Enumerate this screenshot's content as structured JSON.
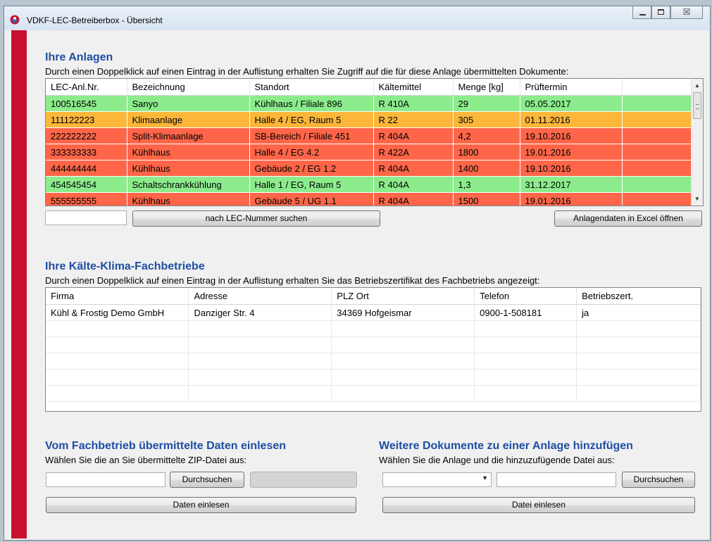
{
  "window": {
    "title": "VDKF-LEC-Betreiberbox - Übersicht",
    "close_glyph": "☒"
  },
  "anlagen": {
    "title": "Ihre Anlagen",
    "description": "Durch einen Doppelklick auf einen Eintrag in der Auflistung erhalten Sie Zugriff auf die für diese Anlage übermittelten Dokumente:",
    "columns": [
      "LEC-Anl.Nr.",
      "Bezeichnung",
      "Standort",
      "Kältemittel",
      "Menge [kg]",
      "Prüftermin",
      ""
    ],
    "rows": [
      {
        "status": "green",
        "cells": [
          "100516545",
          "Sanyo",
          "Kühlhaus / Filiale 896",
          "R 410A",
          "29",
          "05.05.2017",
          ""
        ]
      },
      {
        "status": "orange",
        "cells": [
          "111122223",
          "Klimaanlage",
          "Halle 4 / EG, Raum 5",
          "R 22",
          "305",
          "01.11.2016",
          ""
        ]
      },
      {
        "status": "red",
        "cells": [
          "222222222",
          "Split-Klimaanlage",
          "SB-Bereich / Filiale 451",
          "R 404A",
          "4,2",
          "19.10.2016",
          ""
        ]
      },
      {
        "status": "red",
        "cells": [
          "333333333",
          "Kühlhaus",
          "Halle 4 / EG 4.2",
          "R 422A",
          "1800",
          "19.01.2016",
          ""
        ]
      },
      {
        "status": "red",
        "cells": [
          "444444444",
          "Kühlhaus",
          "Gebäude 2 / EG 1.2",
          "R 404A",
          "1400",
          "19.10.2016",
          ""
        ]
      },
      {
        "status": "green",
        "cells": [
          "454545454",
          "Schaltschrankkühlung",
          "Halle 1 / EG, Raum 5",
          "R 404A",
          "1,3",
          "31.12.2017",
          ""
        ]
      },
      {
        "status": "red",
        "cells": [
          "555555555",
          "Kühlhaus",
          "Gebäude 5 / UG 1.1",
          "R 404A",
          "1500",
          "19.01.2016",
          ""
        ]
      }
    ],
    "search_value": "",
    "search_button": "nach LEC-Nummer suchen",
    "excel_button": "Anlagendaten in Excel öffnen",
    "scroll_up": "▲",
    "scroll_down": "▼"
  },
  "fachbetriebe": {
    "title": "Ihre Kälte-Klima-Fachbetriebe",
    "description": "Durch einen Doppelklick auf einen Eintrag in der Auflistung erhalten Sie das Betriebszertifikat des Fachbetriebs angezeigt:",
    "columns": [
      "Firma",
      "Adresse",
      "PLZ Ort",
      "Telefon",
      "Betriebszert."
    ],
    "rows": [
      [
        "Kühl & Frostig Demo GmbH",
        "Danziger Str. 4",
        "34369 Hofgeismar",
        "0900-1-508181",
        "ja"
      ],
      [
        "",
        "",
        "",
        "",
        ""
      ],
      [
        "",
        "",
        "",
        "",
        ""
      ],
      [
        "",
        "",
        "",
        "",
        ""
      ],
      [
        "",
        "",
        "",
        "",
        ""
      ],
      [
        "",
        "",
        "",
        "",
        ""
      ]
    ]
  },
  "import": {
    "title": "Vom Fachbetrieb übermittelte Daten einlesen",
    "description": "Wählen Sie die an Sie übermittelte ZIP-Datei aus:",
    "file_value": "",
    "browse_button": "Durchsuchen",
    "import_button": "Daten einlesen"
  },
  "documents": {
    "title": "Weitere Dokumente zu einer Anlage hinzufügen",
    "description": "Wählen Sie die Anlage und die hinzuzufügende Datei aus:",
    "anlage_selected": "",
    "file_value": "",
    "browse_button": "Durchsuchen",
    "import_button": "Datei einlesen"
  },
  "colors": {
    "green": "#8cec8c",
    "orange": "#fcb63a",
    "red": "#ff6649",
    "accent": "#c8102e",
    "heading": "#1f4ea3"
  }
}
